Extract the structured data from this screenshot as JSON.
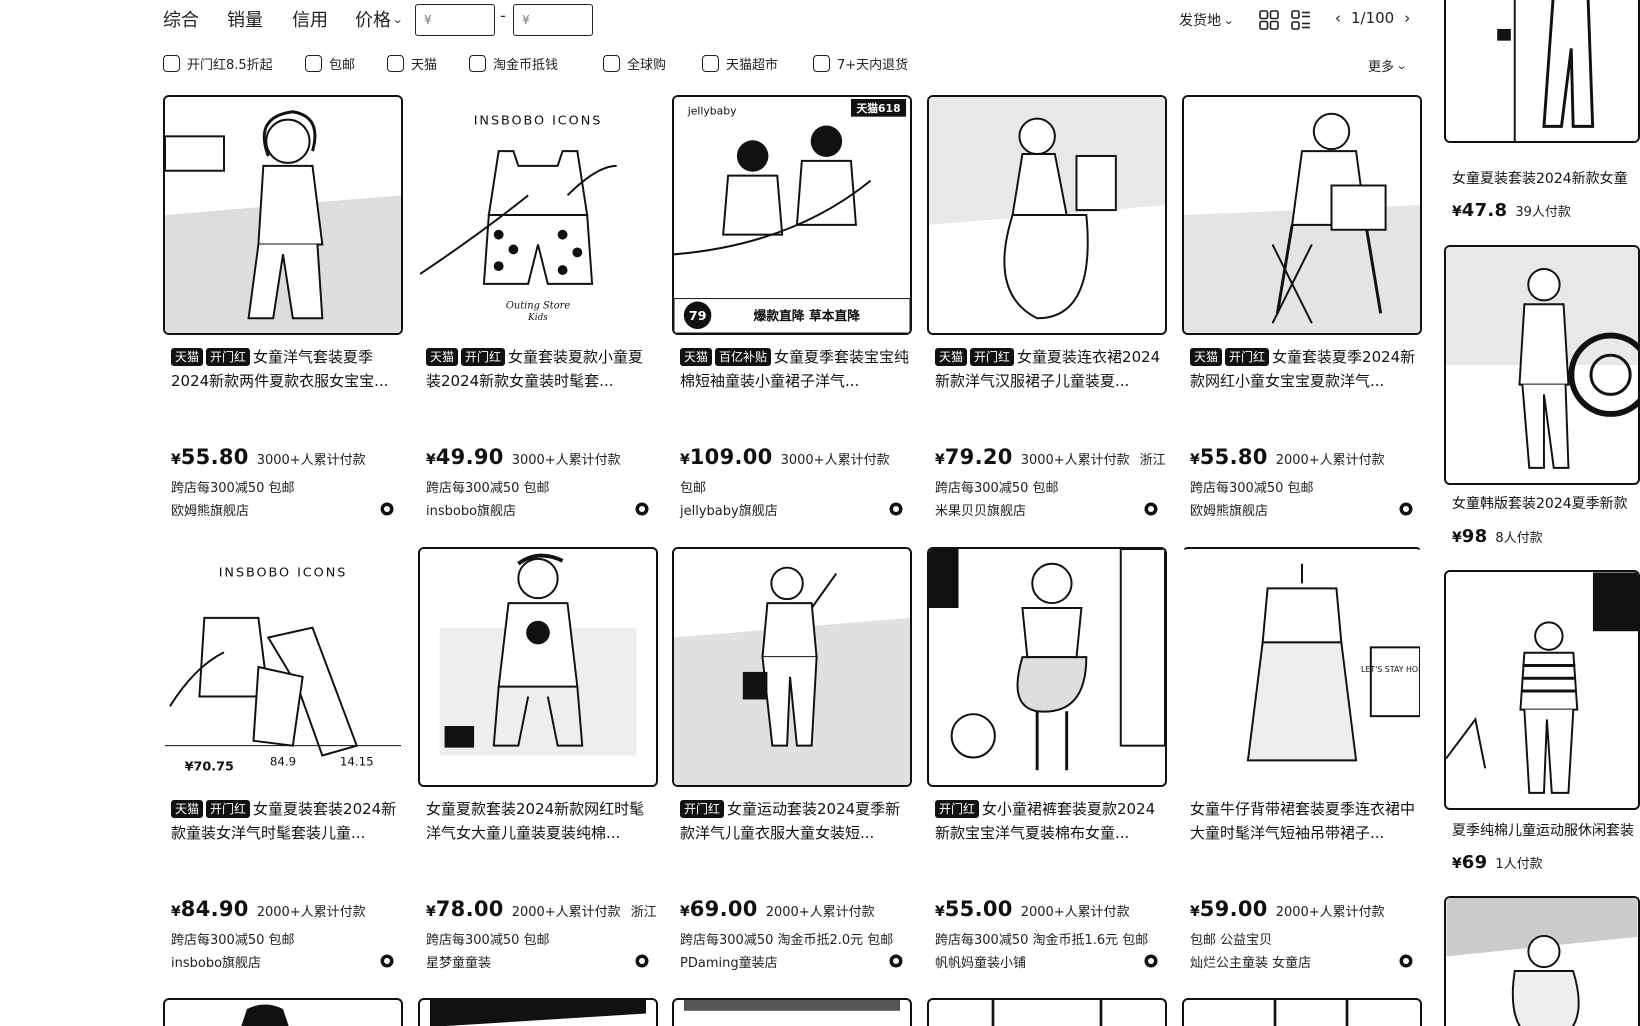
{
  "sort": {
    "tabs": [
      "综合",
      "销量",
      "信用"
    ],
    "price_label": "价格",
    "price_min_placeholder": "¥",
    "price_max_placeholder": "¥",
    "price_dash": "-",
    "ship_from": "发货地",
    "page_current": "1/100"
  },
  "filters": {
    "items": [
      "开门红8.5折起",
      "包邮",
      "天猫",
      "淘金币抵钱",
      "全球购",
      "天猫超市",
      "7+天内退货"
    ],
    "more": "更多"
  },
  "products": [
    {
      "tags": [
        "天猫",
        "开门红"
      ],
      "title": "女童洋气套装夏季2024新款两件夏款衣服女宝宝...",
      "yen": "¥",
      "price": "55.80",
      "sold": "3000+人累计付款",
      "loc": "",
      "promo": "跨店每300减50  包邮",
      "shop": "欧姆熊旗舰店"
    },
    {
      "tags": [
        "天猫",
        "开门红"
      ],
      "title": "女童套装夏款小童夏装2024新款女童装时髦套...",
      "yen": "¥",
      "price": "49.90",
      "sold": "3000+人累计付款",
      "loc": "",
      "promo": "跨店每300减50  包邮",
      "shop": "insbobo旗舰店"
    },
    {
      "tags": [
        "天猫",
        "百亿补贴"
      ],
      "title": "女童夏季套装宝宝纯棉短袖童装小童裙子洋气...",
      "yen": "¥",
      "price": "109.00",
      "sold": "3000+人累计付款",
      "loc": "",
      "promo": "包邮",
      "shop": "jellybaby旗舰店"
    },
    {
      "tags": [
        "天猫",
        "开门红"
      ],
      "title": "女童夏装连衣裙2024新款洋气汉服裙子儿童装夏...",
      "yen": "¥",
      "price": "79.20",
      "sold": "3000+人累计付款",
      "loc": "浙江",
      "promo": "跨店每300减50  包邮",
      "shop": "米果贝贝旗舰店"
    },
    {
      "tags": [
        "天猫",
        "开门红"
      ],
      "title": "女童套装夏季2024新款网红小童女宝宝夏款洋气...",
      "yen": "¥",
      "price": "55.80",
      "sold": "2000+人累计付款",
      "loc": "",
      "promo": "跨店每300减50  包邮",
      "shop": "欧姆熊旗舰店"
    },
    {
      "tags": [
        "天猫",
        "开门红"
      ],
      "title": "女童夏装套装2024新款童装女洋气时髦套装儿童...",
      "yen": "¥",
      "price": "84.90",
      "sold": "2000+人累计付款",
      "loc": "",
      "promo": "跨店每300减50  包邮",
      "shop": "insbobo旗舰店"
    },
    {
      "tags": [],
      "title": "女童夏款套装2024新款网红时髦洋气女大童儿童装夏装纯棉...",
      "yen": "¥",
      "price": "78.00",
      "sold": "2000+人累计付款",
      "loc": "浙江",
      "promo": "跨店每300减50  包邮",
      "shop": "星梦童童装"
    },
    {
      "tags": [
        "开门红"
      ],
      "title": "女童运动套装2024夏季新款洋气儿童衣服大童女装短...",
      "yen": "¥",
      "price": "69.00",
      "sold": "2000+人累计付款",
      "loc": "",
      "promo": "跨店每300减50  淘金币抵2.0元  包邮",
      "shop": "PDaming童装店"
    },
    {
      "tags": [
        "开门红"
      ],
      "title": "女小童裙裤套装夏款2024新款宝宝洋气夏装棉布女童...",
      "yen": "¥",
      "price": "55.00",
      "sold": "2000+人累计付款",
      "loc": "",
      "promo": "跨店每300减50  淘金币抵1.6元  包邮",
      "shop": "帆帆妈童装小铺"
    },
    {
      "tags": [],
      "title": "女童牛仔背带裙套装夏季连衣裙中大童时髦洋气短袖吊带裙子...",
      "yen": "¥",
      "price": "59.00",
      "sold": "2000+人累计付款",
      "loc": "",
      "promo": "包邮  公益宝贝",
      "shop": "灿烂公主童装 女童店"
    }
  ],
  "thumb_texts": {
    "insbobo": "INSBOBO ICONS",
    "sig": "Outing Store",
    "sig2": "Kids",
    "tmall": "天猫618",
    "jelly": "jellybaby",
    "p79": "79",
    "jelly_banner": "爆款直降 草本直降",
    "p7075": "¥70.75",
    "p849": "84.9",
    "p1415": "14.15",
    "letsstay": "LET'S STAY HOME"
  },
  "side": [
    {
      "title": "女童夏装套装2024新款女童",
      "yen": "¥",
      "price": "47.8",
      "sold": "39人付款"
    },
    {
      "title": "女童韩版套装2024夏季新款",
      "yen": "¥",
      "price": "98",
      "sold": "8人付款"
    },
    {
      "title": "夏季纯棉儿童运动服休闲套装",
      "yen": "¥",
      "price": "69",
      "sold": "1人付款"
    }
  ]
}
